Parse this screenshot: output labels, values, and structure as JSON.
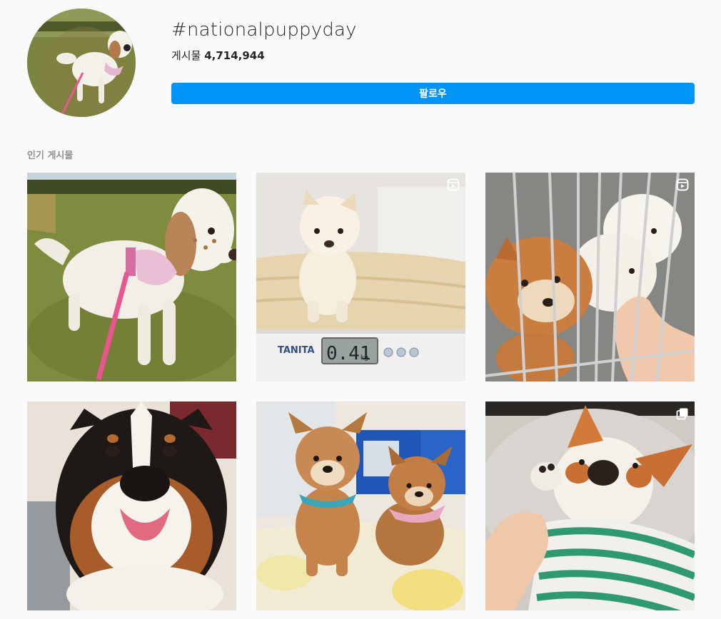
{
  "hashtag": {
    "title": "#nationalpuppyday",
    "post_count_label": "게시물",
    "post_count": "4,714,944",
    "follow_label": "팔로우"
  },
  "top_posts": {
    "label": "인기 게시물",
    "posts": [
      {
        "subject": "english-setter",
        "badge": null,
        "bg": "#7a8a3e"
      },
      {
        "subject": "white-puppy-on-scale",
        "badge": "reels-icon",
        "bg": "#d9d2c4",
        "scale_brand": "TANITA",
        "scale_reading": "0.41",
        "scale_unit": "kg"
      },
      {
        "subject": "shiba-puppies-in-pen",
        "badge": "reels-icon",
        "bg": "#8d8d8a"
      },
      {
        "subject": "bernese-mountain-dog",
        "badge": null,
        "bg": "#2a2220"
      },
      {
        "subject": "two-shiba-puppies",
        "badge": null,
        "bg": "#e8e4dc"
      },
      {
        "subject": "corgi-mix-in-sweater",
        "badge": "carousel-icon",
        "bg": "#c9c5c0"
      }
    ]
  },
  "colors": {
    "accent": "#0095f6",
    "background": "#fafafa",
    "muted_text": "#8e8e8e"
  }
}
